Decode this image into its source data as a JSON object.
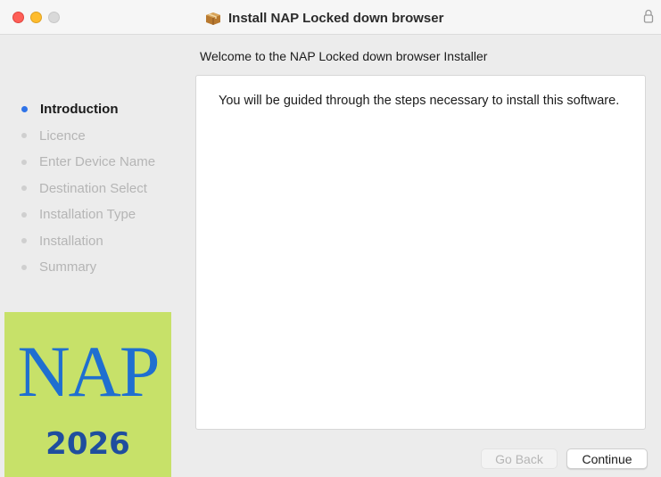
{
  "window": {
    "title": "Install NAP Locked down browser",
    "title_icon": "package-icon",
    "lock_icon": "lock-icon"
  },
  "heading": "Welcome to the NAP Locked down browser Installer",
  "steps": [
    {
      "label": "Introduction",
      "active": true
    },
    {
      "label": "Licence",
      "active": false
    },
    {
      "label": "Enter Device Name",
      "active": false
    },
    {
      "label": "Destination Select",
      "active": false
    },
    {
      "label": "Installation Type",
      "active": false
    },
    {
      "label": "Installation",
      "active": false
    },
    {
      "label": "Summary",
      "active": false
    }
  ],
  "logo": {
    "text": "NAP",
    "year": "2026",
    "background_color": "#c7e169",
    "text_color": "#1f6fd0"
  },
  "content": {
    "message": "You will be guided through the steps necessary to install this software."
  },
  "buttons": {
    "back_label": "Go Back",
    "back_enabled": false,
    "continue_label": "Continue"
  },
  "colors": {
    "active_step": "#2f73e8",
    "close": "#fe5f57",
    "minimize": "#febc2e"
  }
}
